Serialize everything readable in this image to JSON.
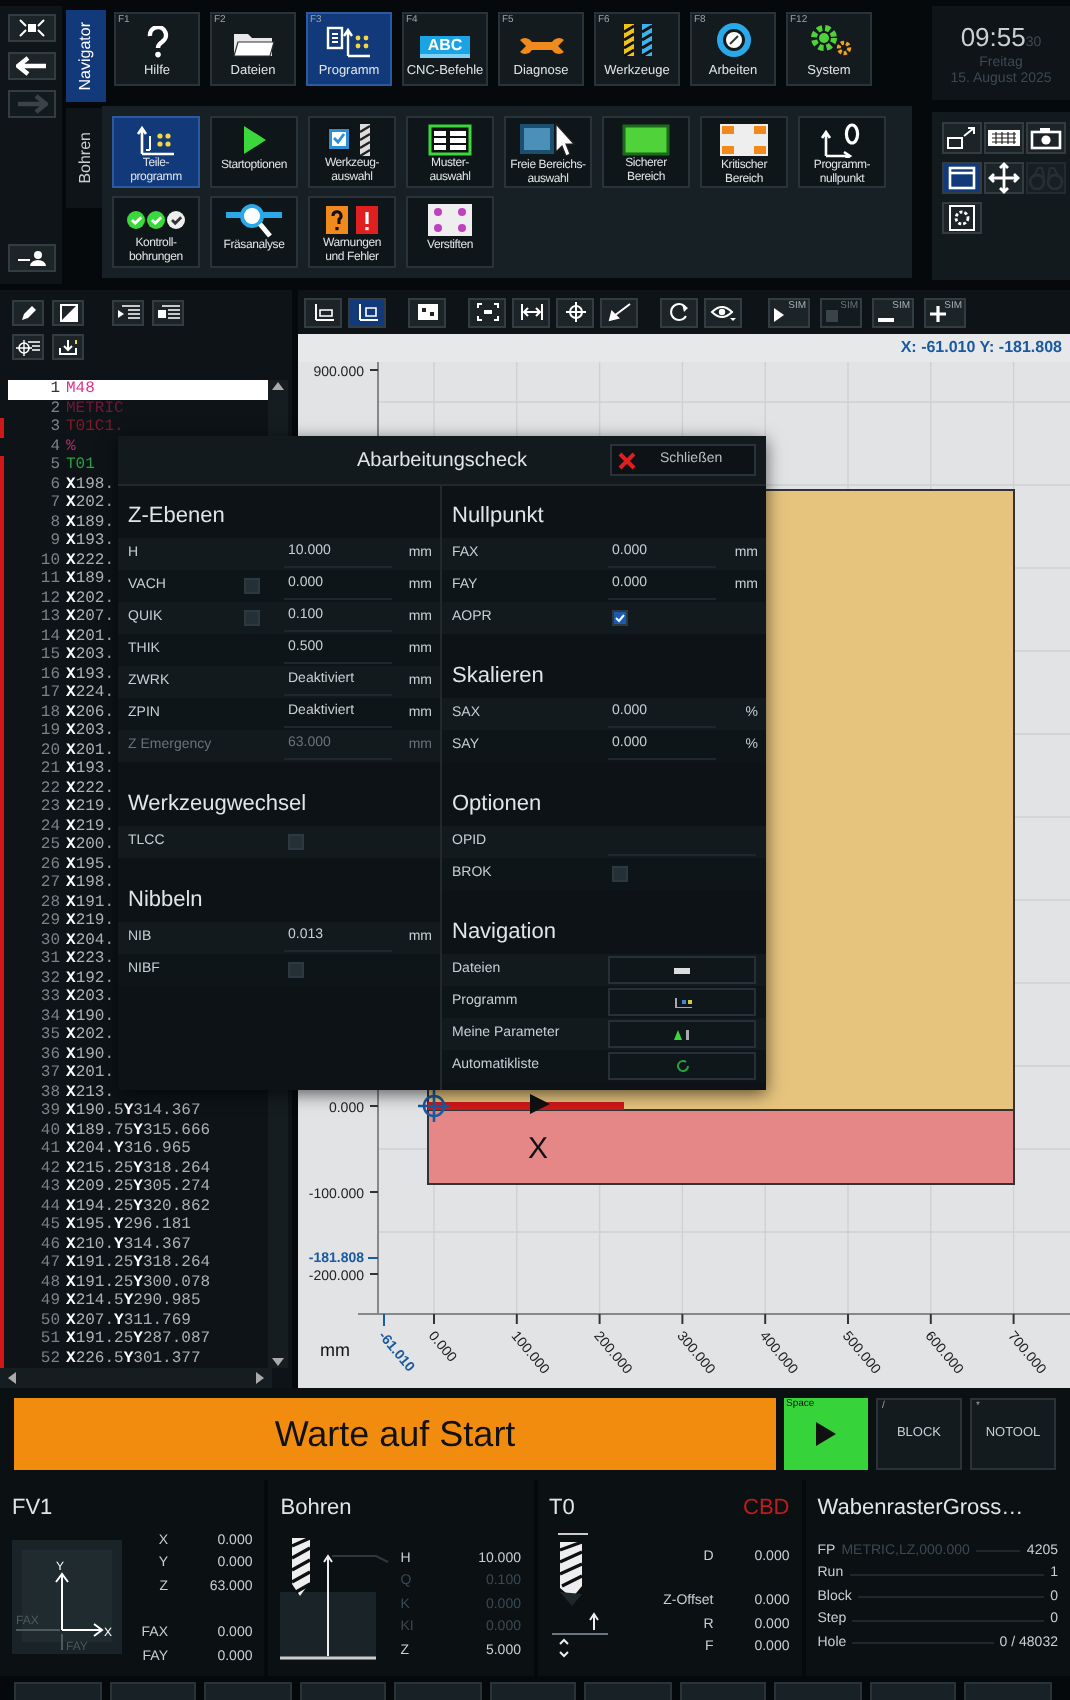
{
  "history": [
    {
      "disabled": false
    },
    {
      "disabled": true
    }
  ],
  "nav_tabs": [
    {
      "label": "Navigator",
      "selected": true
    },
    {
      "label": "Bohren",
      "selected": false
    }
  ],
  "function_keys": [
    {
      "key": "F1",
      "label": "Hilfe",
      "selected": false
    },
    {
      "key": "F2",
      "label": "Dateien",
      "selected": false
    },
    {
      "key": "F3",
      "label": "Programm",
      "selected": true
    },
    {
      "key": "F4",
      "label": "CNC-Befehle",
      "selected": false,
      "icon_text": "ABC"
    },
    {
      "key": "F5",
      "label": "Diagnose",
      "selected": false
    },
    {
      "key": "F6",
      "label": "Werkzeuge",
      "selected": false
    },
    {
      "key": "F8",
      "label": "Arbeiten",
      "selected": false
    },
    {
      "key": "F12",
      "label": "System",
      "selected": false
    }
  ],
  "submenu": [
    [
      {
        "label": "Teile-\nprogramm",
        "selected": true
      },
      {
        "label": "Startoptionen",
        "selected": false
      },
      {
        "label": "Werkzeug-\nauswahl",
        "selected": false
      },
      {
        "label": "Muster-\nauswahl",
        "selected": false
      },
      {
        "label": "Freie Bereichs-\nauswahl",
        "selected": false
      },
      {
        "label": "Sicherer\nBereich",
        "selected": false
      },
      {
        "label": "Kritischer\nBereich",
        "selected": false
      },
      {
        "label": "Programm-\nnullpunkt",
        "selected": false
      }
    ],
    [
      {
        "label": "Kontroll-\nbohrungen",
        "selected": false
      },
      {
        "label": "Fräsanalyse",
        "selected": false
      },
      {
        "label": "Warnungen\nund Fehler",
        "selected": false
      },
      {
        "label": "Verstiften",
        "selected": false
      }
    ]
  ],
  "clock": {
    "time": "09:55",
    "seconds": "30",
    "day": "Freitag",
    "date": "15. August 2025"
  },
  "quick_tools": [
    {
      "selected": false,
      "disabled": false
    },
    {
      "selected": false,
      "disabled": false
    },
    {
      "selected": false,
      "disabled": false
    },
    {
      "selected": true,
      "disabled": false
    },
    {
      "selected": false,
      "disabled": false
    },
    {
      "selected": false,
      "disabled": true
    },
    {
      "selected": false,
      "disabled": false
    }
  ],
  "editor": {
    "lines": [
      {
        "number": "1",
        "code": "M48",
        "kind": "command",
        "selected": true,
        "marked": false
      },
      {
        "number": "2",
        "code": "METRIC",
        "kind": "header",
        "selected": false,
        "marked": false
      },
      {
        "number": "3",
        "code": "T01C1.",
        "kind": "tool_def",
        "selected": false,
        "marked": true
      },
      {
        "number": "4",
        "code": "%",
        "kind": "percent",
        "selected": false,
        "marked": false
      },
      {
        "number": "5",
        "code": "T01",
        "kind": "tool",
        "selected": false,
        "marked": true
      },
      {
        "number": "6",
        "code": "**X**198.",
        "kind": "coord",
        "selected": false,
        "marked": true
      },
      {
        "number": "7",
        "code": "**X**202.",
        "kind": "coord",
        "selected": false,
        "marked": true
      },
      {
        "number": "8",
        "code": "**X**189.",
        "kind": "coord",
        "selected": false,
        "marked": true
      },
      {
        "number": "9",
        "code": "**X**193.",
        "kind": "coord",
        "selected": false,
        "marked": true
      },
      {
        "number": "10",
        "code": "**X**222.",
        "kind": "coord",
        "selected": false,
        "marked": true
      },
      {
        "number": "11",
        "code": "**X**189.",
        "kind": "coord",
        "selected": false,
        "marked": true
      },
      {
        "number": "12",
        "code": "**X**202.",
        "kind": "coord",
        "selected": false,
        "marked": true
      },
      {
        "number": "13",
        "code": "**X**207.",
        "kind": "coord",
        "selected": false,
        "marked": true
      },
      {
        "number": "14",
        "code": "**X**201.",
        "kind": "coord",
        "selected": false,
        "marked": true
      },
      {
        "number": "15",
        "code": "**X**203.",
        "kind": "coord",
        "selected": false,
        "marked": true
      },
      {
        "number": "16",
        "code": "**X**193.",
        "kind": "coord",
        "selected": false,
        "marked": true
      },
      {
        "number": "17",
        "code": "**X**224.",
        "kind": "coord",
        "selected": false,
        "marked": true
      },
      {
        "number": "18",
        "code": "**X**206.",
        "kind": "coord",
        "selected": false,
        "marked": true
      },
      {
        "number": "19",
        "code": "**X**203.",
        "kind": "coord",
        "selected": false,
        "marked": true
      },
      {
        "number": "20",
        "code": "**X**201.",
        "kind": "coord",
        "selected": false,
        "marked": true
      },
      {
        "number": "21",
        "code": "**X**193.",
        "kind": "coord",
        "selected": false,
        "marked": true
      },
      {
        "number": "22",
        "code": "**X**222.",
        "kind": "coord",
        "selected": false,
        "marked": true
      },
      {
        "number": "23",
        "code": "**X**219.",
        "kind": "coord",
        "selected": false,
        "marked": true
      },
      {
        "number": "24",
        "code": "**X**219.",
        "kind": "coord",
        "selected": false,
        "marked": true
      },
      {
        "number": "25",
        "code": "**X**200.",
        "kind": "coord",
        "selected": false,
        "marked": true
      },
      {
        "number": "26",
        "code": "**X**195.",
        "kind": "coord",
        "selected": false,
        "marked": true
      },
      {
        "number": "27",
        "code": "**X**198.",
        "kind": "coord",
        "selected": false,
        "marked": true
      },
      {
        "number": "28",
        "code": "**X**191.",
        "kind": "coord",
        "selected": false,
        "marked": true
      },
      {
        "number": "29",
        "code": "**X**219.",
        "kind": "coord",
        "selected": false,
        "marked": true
      },
      {
        "number": "30",
        "code": "**X**204.",
        "kind": "coord",
        "selected": false,
        "marked": true
      },
      {
        "number": "31",
        "code": "**X**223.",
        "kind": "coord",
        "selected": false,
        "marked": true
      },
      {
        "number": "32",
        "code": "**X**192.",
        "kind": "coord",
        "selected": false,
        "marked": true
      },
      {
        "number": "33",
        "code": "**X**203.",
        "kind": "coord",
        "selected": false,
        "marked": true
      },
      {
        "number": "34",
        "code": "**X**190.",
        "kind": "coord",
        "selected": false,
        "marked": true
      },
      {
        "number": "35",
        "code": "**X**202.",
        "kind": "coord",
        "selected": false,
        "marked": true
      },
      {
        "number": "36",
        "code": "**X**190.",
        "kind": "coord",
        "selected": false,
        "marked": true
      },
      {
        "number": "37",
        "code": "**X**201.",
        "kind": "coord",
        "selected": false,
        "marked": true
      },
      {
        "number": "38",
        "code": "**X**213.",
        "kind": "coord",
        "selected": false,
        "marked": true
      },
      {
        "number": "39",
        "code": "**X**190.5**Y**314.367",
        "kind": "coord",
        "selected": false,
        "marked": true
      },
      {
        "number": "40",
        "code": "**X**189.75**Y**315.666",
        "kind": "coord",
        "selected": false,
        "marked": true
      },
      {
        "number": "41",
        "code": "**X**204.**Y**316.965",
        "kind": "coord",
        "selected": false,
        "marked": true
      },
      {
        "number": "42",
        "code": "**X**215.25**Y**318.264",
        "kind": "coord",
        "selected": false,
        "marked": true
      },
      {
        "number": "43",
        "code": "**X**209.25**Y**305.274",
        "kind": "coord",
        "selected": false,
        "marked": true
      },
      {
        "number": "44",
        "code": "**X**194.25**Y**320.862",
        "kind": "coord",
        "selected": false,
        "marked": true
      },
      {
        "number": "45",
        "code": "**X**195.**Y**296.181",
        "kind": "coord",
        "selected": false,
        "marked": true
      },
      {
        "number": "46",
        "code": "**X**210.**Y**314.367",
        "kind": "coord",
        "selected": false,
        "marked": true
      },
      {
        "number": "47",
        "code": "**X**191.25**Y**318.264",
        "kind": "coord",
        "selected": false,
        "marked": true
      },
      {
        "number": "48",
        "code": "**X**191.25**Y**300.078",
        "kind": "coord",
        "selected": false,
        "marked": true
      },
      {
        "number": "49",
        "code": "**X**214.5**Y**290.985",
        "kind": "coord",
        "selected": false,
        "marked": true
      },
      {
        "number": "50",
        "code": "**X**207.**Y**311.769",
        "kind": "coord",
        "selected": false,
        "marked": true
      },
      {
        "number": "51",
        "code": "**X**191.25**Y**287.087",
        "kind": "coord",
        "selected": false,
        "marked": true
      },
      {
        "number": "52",
        "code": "**X**226.5**Y**301.377",
        "kind": "coord",
        "selected": false,
        "marked": true
      }
    ]
  },
  "view_modes": [
    {
      "selected": false
    },
    {
      "selected": true
    }
  ],
  "sim_buttons": [
    {
      "label": "SIM",
      "disabled": false
    },
    {
      "label": "SIM",
      "disabled": true
    },
    {
      "label": "SIM",
      "disabled": false
    },
    {
      "label": "SIM",
      "disabled": false
    }
  ],
  "plot": {
    "readout": "X: -61.010 Y: -181.808",
    "y_ticks": [
      "900.000",
      "0.000",
      "-100.000",
      "-200.000"
    ],
    "y_cursor": "-181.808",
    "x_ticks": [
      "0.000",
      "100.000",
      "200.000",
      "300.000",
      "400.000",
      "500.000",
      "600.000",
      "700.000"
    ],
    "x_cursor": "-61.010",
    "unit": "mm",
    "direction_label": "X"
  },
  "dialog": {
    "title": "Abarbeitungscheck",
    "close_label": "Schließen",
    "columns": [
      [
        {
          "title": "Z-Ebenen",
          "rows": [
            {
              "kind": "value",
              "label": "H",
              "value": "10.000",
              "unit": "mm",
              "disabled": false
            },
            {
              "kind": "check_value",
              "label": "VACH",
              "checked": false,
              "value": "0.000",
              "unit": "mm",
              "disabled": false
            },
            {
              "kind": "check_value",
              "label": "QUIK",
              "checked": false,
              "value": "0.100",
              "unit": "mm",
              "disabled": false
            },
            {
              "kind": "value",
              "label": "THIK",
              "value": "0.500",
              "unit": "mm",
              "disabled": false
            },
            {
              "kind": "value",
              "label": "ZWRK",
              "value": "Deaktiviert",
              "unit": "mm",
              "disabled": false
            },
            {
              "kind": "value",
              "label": "ZPIN",
              "value": "Deaktiviert",
              "unit": "mm",
              "disabled": false
            },
            {
              "kind": "value",
              "label": "Z Emergency",
              "value": "63.000",
              "unit": "mm",
              "disabled": true
            }
          ]
        },
        {
          "title": "Werkzeugwechsel",
          "rows": [
            {
              "kind": "checkbox",
              "label": "TLCC",
              "checked": false
            }
          ]
        },
        {
          "title": "Nibbeln",
          "rows": [
            {
              "kind": "value",
              "label": "NIB",
              "value": "0.013",
              "unit": "mm"
            },
            {
              "kind": "checkbox",
              "label": "NIBF",
              "checked": false
            }
          ]
        }
      ],
      [
        {
          "title": "Nullpunkt",
          "rows": [
            {
              "kind": "value",
              "label": "FAX",
              "value": "0.000",
              "unit": "mm"
            },
            {
              "kind": "value",
              "label": "FAY",
              "value": "0.000",
              "unit": "mm"
            },
            {
              "kind": "checkbox",
              "label": "AOPR",
              "checked": true
            }
          ]
        },
        {
          "title": "Skalieren",
          "rows": [
            {
              "kind": "value",
              "label": "SAX",
              "value": "0.000",
              "unit": "%"
            },
            {
              "kind": "value",
              "label": "SAY",
              "value": "0.000",
              "unit": "%"
            }
          ]
        },
        {
          "title": "Optionen",
          "rows": [
            {
              "kind": "field",
              "label": "OPID"
            },
            {
              "kind": "checkbox",
              "label": "BROK",
              "checked": false
            }
          ]
        },
        {
          "title": "Navigation",
          "rows": [
            {
              "kind": "nav",
              "label": "Dateien"
            },
            {
              "kind": "nav",
              "label": "Programm"
            },
            {
              "kind": "nav",
              "label": "Meine Parameter"
            },
            {
              "kind": "nav",
              "label": "Automatikliste"
            }
          ]
        }
      ]
    ]
  },
  "status": {
    "message": "Warte auf Start",
    "start_hotkey": "Space",
    "toggles": [
      {
        "hotkey": "/",
        "label": "BLOCK"
      },
      {
        "hotkey": "*",
        "label": "NOTOOL"
      }
    ]
  },
  "panels": [
    {
      "kind": "axes",
      "title": "FV1",
      "axis_y": "Y",
      "axis_x": "X",
      "offset_x": "FAX",
      "offset_y": "FAY",
      "rows": [
        {
          "label": "X",
          "value": "0.000"
        },
        {
          "label": "Y",
          "value": "0.000"
        },
        {
          "label": "Z",
          "value": "63.000"
        }
      ],
      "offset_rows": [
        {
          "label": "FAX",
          "value": "0.000"
        },
        {
          "label": "FAY",
          "value": "0.000"
        }
      ]
    },
    {
      "kind": "drill",
      "title": "Bohren",
      "rows": [
        {
          "label": "H",
          "value": "10.000",
          "disabled": false
        },
        {
          "label": "Q",
          "value": "0.100",
          "disabled": true
        },
        {
          "label": "K",
          "value": "0.000",
          "disabled": true
        },
        {
          "label": "KI",
          "value": "0.000",
          "disabled": true
        },
        {
          "label": "Z",
          "value": "5.000",
          "disabled": false
        }
      ]
    },
    {
      "kind": "tool",
      "title": "T0",
      "tag": "CBD",
      "rows": [
        {
          "label": "D",
          "value": "0.000"
        },
        {
          "label": "Z-Offset",
          "value": "0.000"
        },
        {
          "label": "R",
          "value": "0.000"
        },
        {
          "label": "F",
          "value": "0.000"
        }
      ]
    },
    {
      "kind": "program",
      "title": "WabenrasterGross…",
      "rows": [
        {
          "label": "FP",
          "note": "METRIC,LZ,000.000",
          "value": "4205"
        },
        {
          "label": "Run",
          "value": "1"
        },
        {
          "label": "Block",
          "value": "0"
        },
        {
          "label": "Step",
          "value": "0"
        },
        {
          "label": "Hole",
          "value": "0 / 48032"
        }
      ]
    }
  ]
}
